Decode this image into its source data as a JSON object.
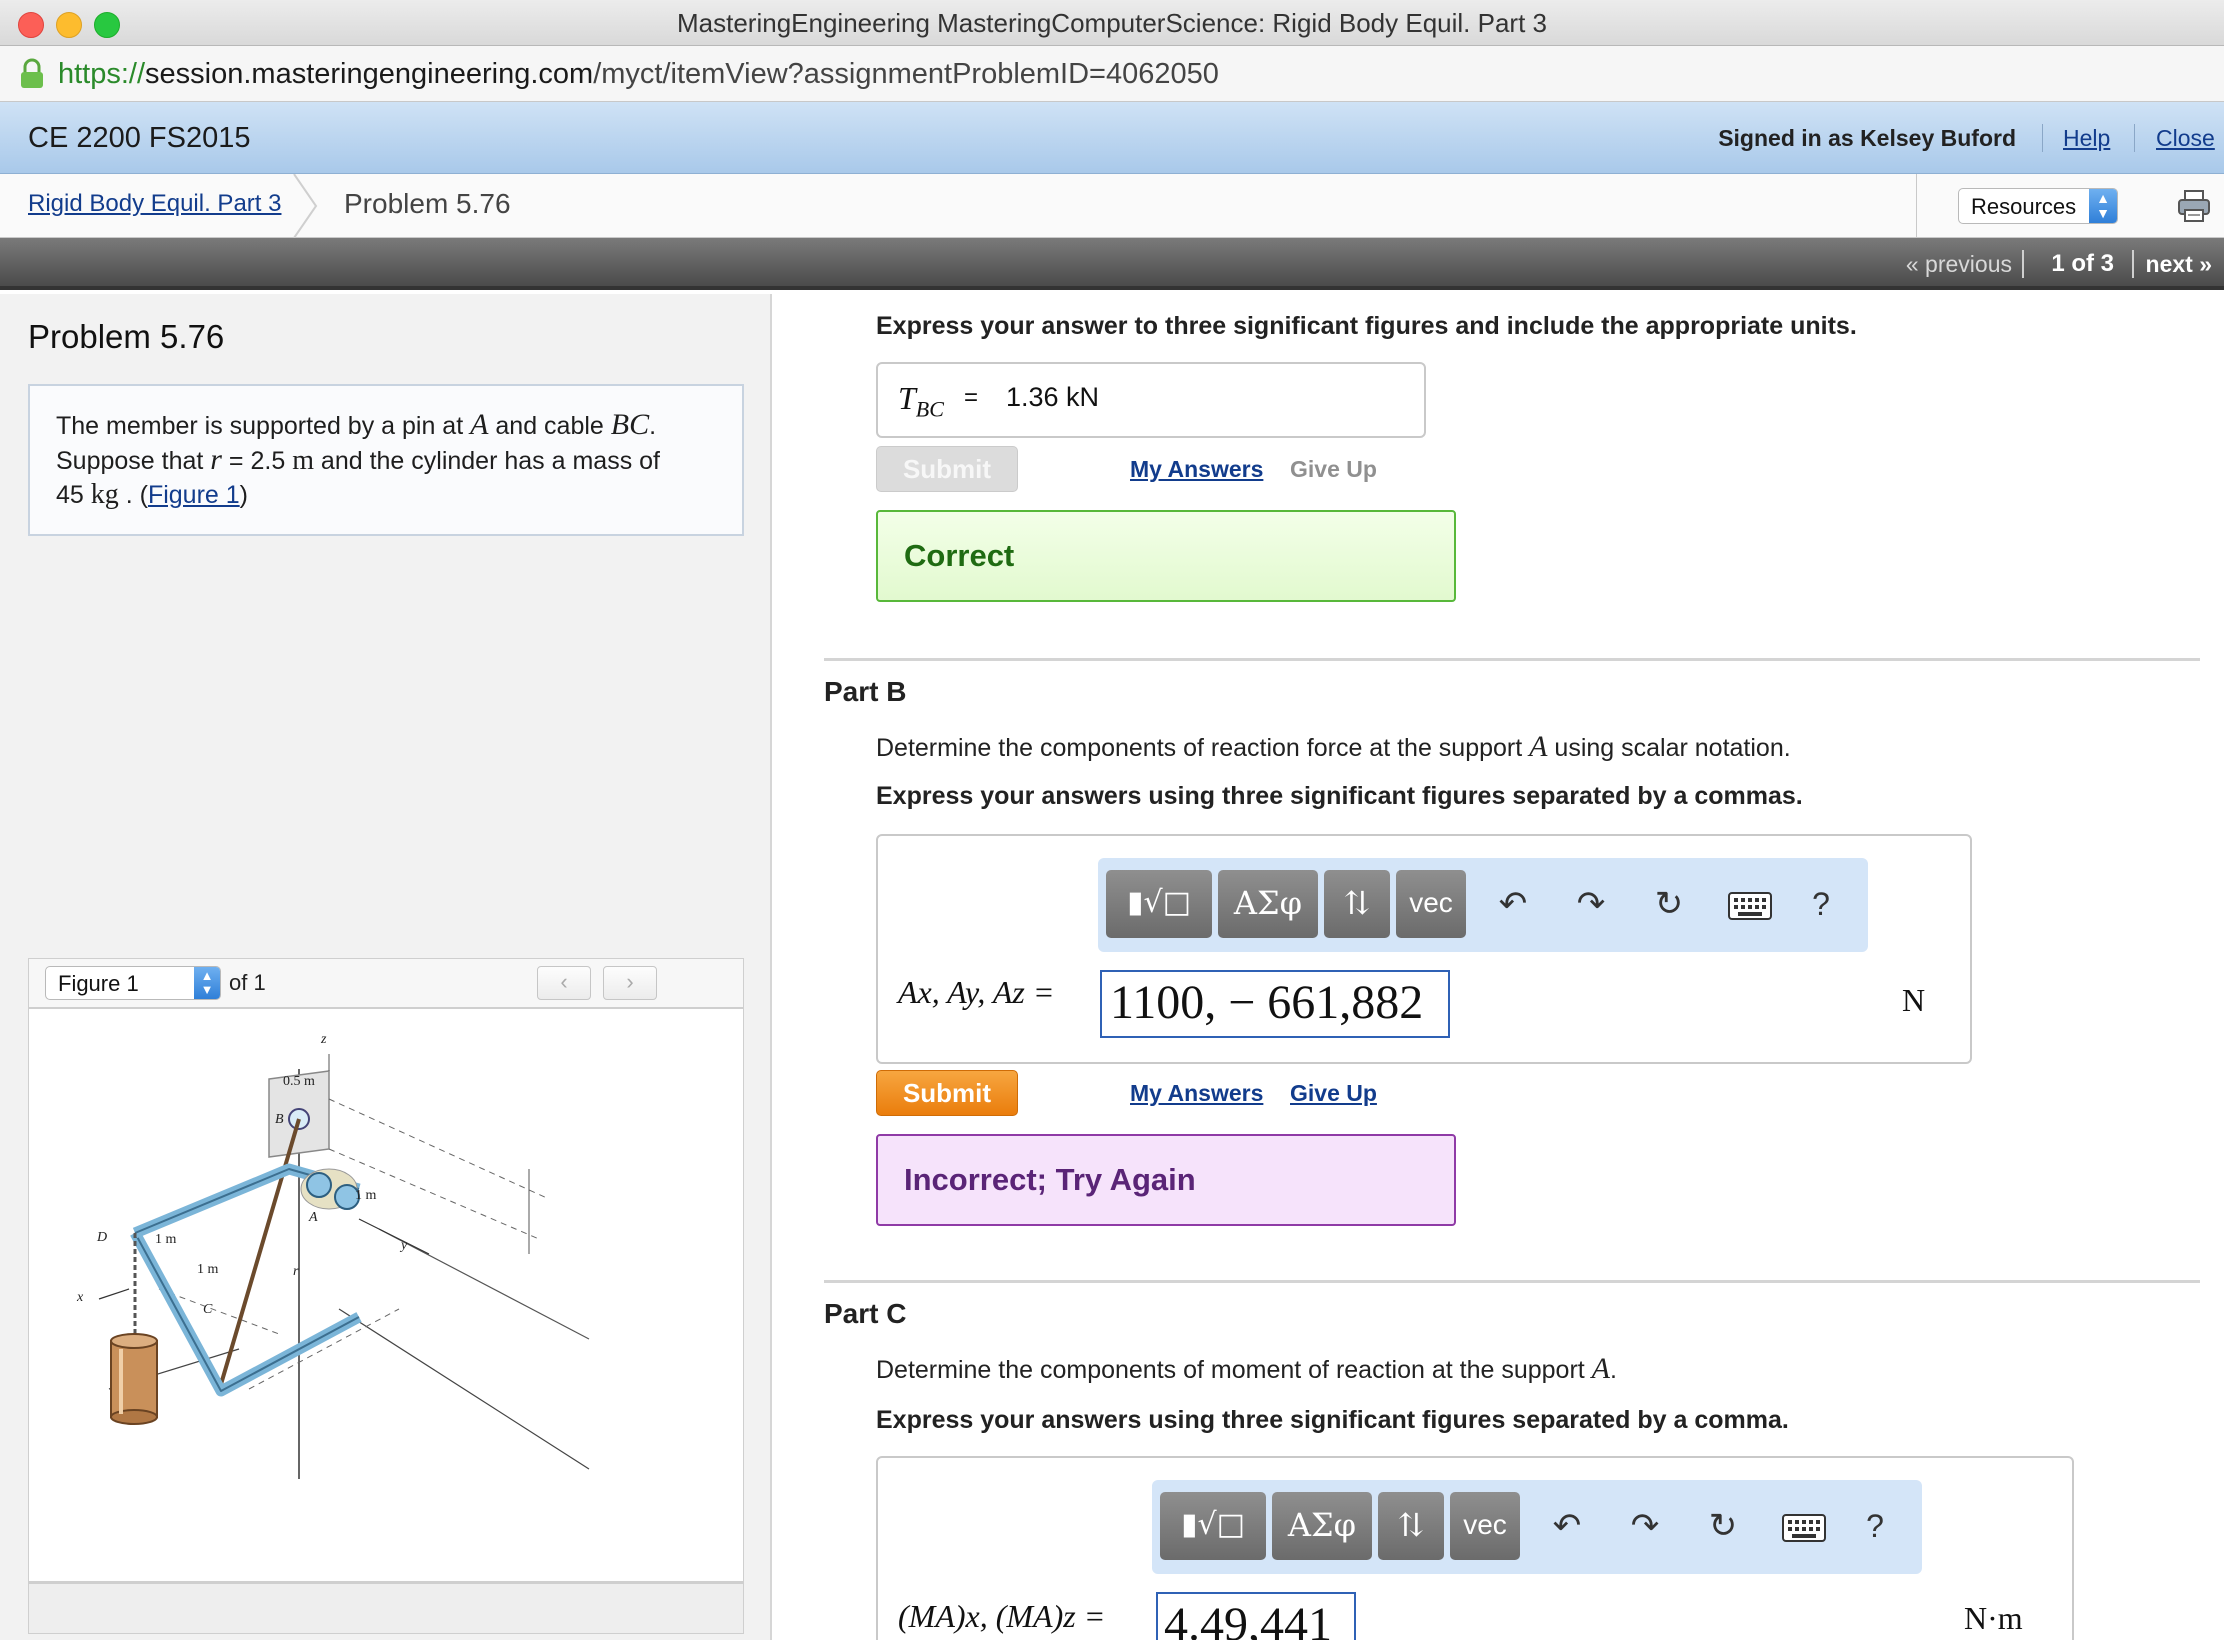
{
  "window": {
    "title": "MasteringEngineering MasteringComputerScience: Rigid Body Equil. Part 3",
    "url_scheme": "https://",
    "url_domain": "session.masteringengineering.com",
    "url_path": "/myct/itemView?assignmentProblemID=4062050",
    "colors": {
      "close": "#fc5f57",
      "minimize": "#fdbc2e",
      "zoom": "#28c840"
    }
  },
  "header": {
    "course": "CE 2200 FS2015",
    "signed_in": "Signed in as Kelsey Buford",
    "help": "Help",
    "close": "Close"
  },
  "breadcrumb": {
    "assignment": "Rigid Body Equil. Part 3",
    "current": "Problem 5.76",
    "resources": "Resources"
  },
  "nav": {
    "previous": "« previous",
    "position": "1 of 3",
    "next": "next »"
  },
  "problem": {
    "title": "Problem 5.76",
    "t1": "The member is supported by a pin at ",
    "A": "A",
    "t2": " and cable ",
    "BC": "BC",
    "t3": ".",
    "t4": "Suppose that ",
    "r": "r",
    "t5": " = 2.5 ",
    "m": "m",
    "t6": " and the cylinder has a mass of",
    "t7": "45 ",
    "kg": "kg",
    "t8": " . (",
    "figure_link": "Figure 1",
    "t9": ")"
  },
  "figure": {
    "selected": "Figure 1",
    "of": "of 1",
    "prev_icon": "chevron-left-icon",
    "next_icon": "chevron-right-icon",
    "labels": {
      "z": "z",
      "dim_half": "0.5 m",
      "B": "B",
      "one_m": "1 m",
      "A": "A",
      "D": "D",
      "one_m_left": "1 m",
      "one_m_low": "1 m",
      "y": "y",
      "r": "r",
      "x": "x",
      "C": "C"
    }
  },
  "part_a": {
    "instruction": "Express your answer to three significant figures and include the appropriate units.",
    "label_T": "T",
    "label_sub": "BC",
    "eq": "=",
    "value": "1.36 kN",
    "submit": "Submit",
    "my_answers": "My Answers",
    "give_up": "Give Up",
    "feedback": "Correct"
  },
  "part_b": {
    "heading": "Part B",
    "desc_pre": "Determine the components of reaction force at the support ",
    "desc_var": "A",
    "desc_post": " using scalar notation.",
    "instruction": "Express your answers using three significant figures separated by a commas.",
    "toolbar": {
      "templates": "▮√□",
      "greek": "ΑΣφ",
      "updown": "⇅",
      "vec": "vec",
      "help": "?"
    },
    "label": "Ax, Ay, Az =",
    "value": "1100, − 661,882",
    "unit": "N",
    "submit": "Submit",
    "my_answers": "My Answers",
    "give_up": "Give Up",
    "feedback": "Incorrect; Try Again"
  },
  "part_c": {
    "heading": "Part C",
    "desc_pre": "Determine the components of moment of reaction at the support ",
    "desc_var": "A",
    "desc_post": ".",
    "instruction": "Express your answers using three significant figures separated by a comma.",
    "toolbar": {
      "templates": "▮√□",
      "greek": "ΑΣφ",
      "updown": "⇅",
      "vec": "vec",
      "help": "?"
    },
    "label": "(MA)x, (MA)z =",
    "value": "4.49,441",
    "unit": "N·m"
  }
}
